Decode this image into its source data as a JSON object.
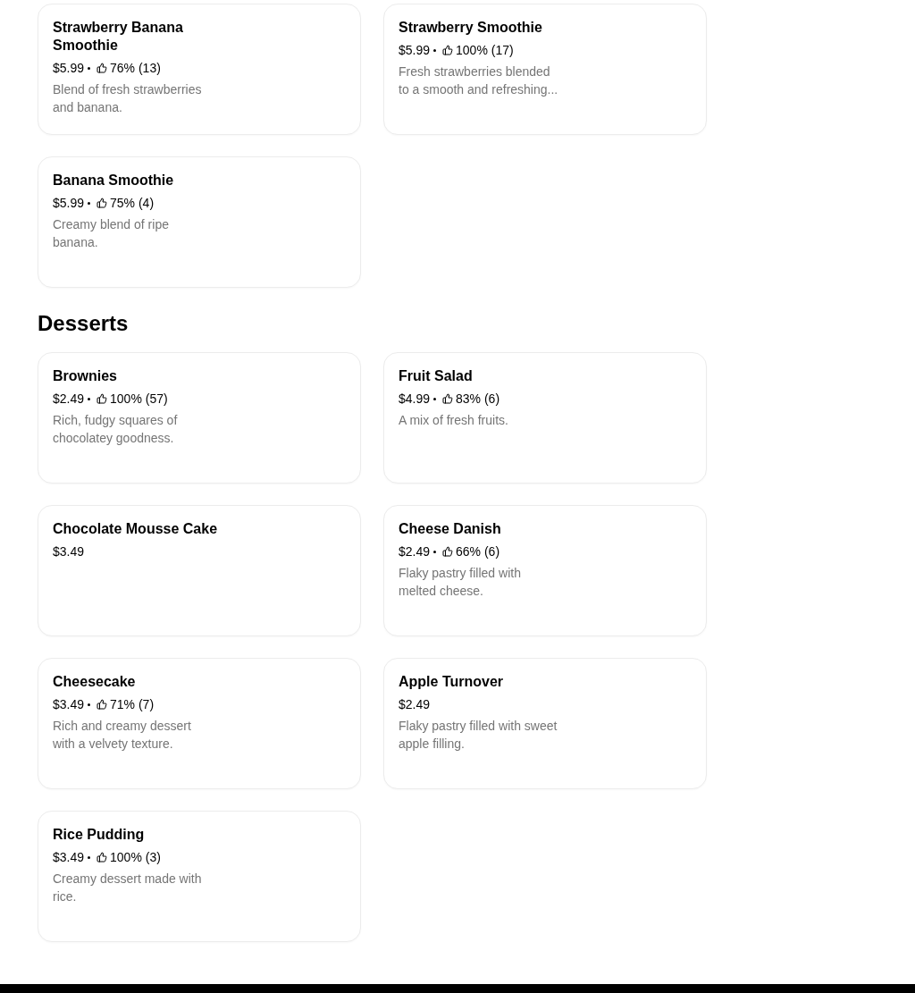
{
  "sections": [
    {
      "items": [
        {
          "name": "Strawberry Banana Smoothie",
          "price": "$5.99",
          "rating": "76% (13)",
          "description": "Blend of fresh strawberries and banana."
        },
        {
          "name": "Strawberry Smoothie",
          "price": "$5.99",
          "rating": "100% (17)",
          "description": "Fresh strawberries blended to a smooth and refreshing..."
        },
        {
          "name": "Banana Smoothie",
          "price": "$5.99",
          "rating": "75% (4)",
          "description": "Creamy blend of ripe banana."
        }
      ]
    },
    {
      "title": "Desserts",
      "items": [
        {
          "name": "Brownies",
          "price": "$2.49",
          "rating": "100% (57)",
          "description": "Rich, fudgy squares of chocolatey goodness."
        },
        {
          "name": "Fruit Salad",
          "price": "$4.99",
          "rating": "83% (6)",
          "description": "A mix of fresh fruits."
        },
        {
          "name": "Chocolate Mousse Cake",
          "price": "$3.49"
        },
        {
          "name": "Cheese Danish",
          "price": "$2.49",
          "rating": "66% (6)",
          "description": "Flaky pastry filled with melted cheese."
        },
        {
          "name": "Cheesecake",
          "price": "$3.49",
          "rating": "71% (7)",
          "description": "Rich and creamy dessert with a velvety texture."
        },
        {
          "name": "Apple Turnover",
          "price": "$2.49",
          "description": "Flaky pastry filled with sweet apple filling."
        },
        {
          "name": "Rice Pudding",
          "price": "$3.49",
          "rating": "100% (3)",
          "description": "Creamy dessert made with rice."
        }
      ]
    }
  ]
}
